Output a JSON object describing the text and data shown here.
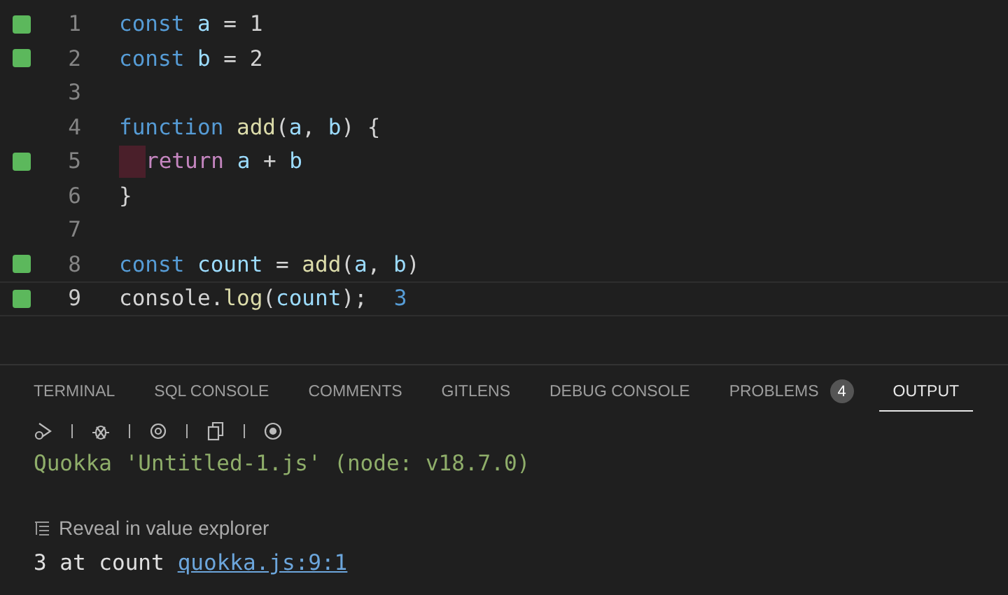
{
  "editor": {
    "lines": [
      {
        "number": "1",
        "covered": true,
        "current": false,
        "indent_error": false,
        "tokens": [
          {
            "kind": "keyword",
            "text": "const "
          },
          {
            "kind": "variable",
            "text": "a"
          },
          {
            "kind": "plain",
            "text": " = "
          },
          {
            "kind": "number",
            "text": "1"
          }
        ]
      },
      {
        "number": "2",
        "covered": true,
        "current": false,
        "indent_error": false,
        "tokens": [
          {
            "kind": "keyword",
            "text": "const "
          },
          {
            "kind": "variable",
            "text": "b"
          },
          {
            "kind": "plain",
            "text": " = "
          },
          {
            "kind": "number",
            "text": "2"
          }
        ]
      },
      {
        "number": "3",
        "covered": false,
        "current": false,
        "indent_error": false
      },
      {
        "number": "4",
        "covered": false,
        "current": false,
        "indent_error": false,
        "tokens": [
          {
            "kind": "keyword",
            "text": "function "
          },
          {
            "kind": "function",
            "text": "add"
          },
          {
            "kind": "plain",
            "text": "("
          },
          {
            "kind": "variable",
            "text": "a"
          },
          {
            "kind": "plain",
            "text": ", "
          },
          {
            "kind": "variable",
            "text": "b"
          },
          {
            "kind": "plain",
            "text": ") {"
          }
        ]
      },
      {
        "number": "5",
        "covered": true,
        "current": false,
        "indent_error": true,
        "tokens": [
          {
            "kind": "control",
            "text": "return "
          },
          {
            "kind": "variable",
            "text": "a"
          },
          {
            "kind": "plain",
            "text": " + "
          },
          {
            "kind": "variable",
            "text": "b"
          }
        ]
      },
      {
        "number": "6",
        "covered": false,
        "current": false,
        "indent_error": false,
        "tokens": [
          {
            "kind": "plain",
            "text": "}"
          }
        ]
      },
      {
        "number": "7",
        "covered": false,
        "current": false,
        "indent_error": false
      },
      {
        "number": "8",
        "covered": true,
        "current": false,
        "indent_error": false,
        "tokens": [
          {
            "kind": "keyword",
            "text": "const "
          },
          {
            "kind": "variable",
            "text": "count"
          },
          {
            "kind": "plain",
            "text": " = "
          },
          {
            "kind": "function",
            "text": "add"
          },
          {
            "kind": "plain",
            "text": "("
          },
          {
            "kind": "variable",
            "text": "a"
          },
          {
            "kind": "plain",
            "text": ", "
          },
          {
            "kind": "variable",
            "text": "b"
          },
          {
            "kind": "plain",
            "text": ")"
          }
        ]
      },
      {
        "number": "9",
        "covered": true,
        "current": true,
        "indent_error": false,
        "inline_value": "3",
        "tokens": [
          {
            "kind": "plain",
            "text": "console"
          },
          {
            "kind": "plain",
            "text": "."
          },
          {
            "kind": "function",
            "text": "log"
          },
          {
            "kind": "plain",
            "text": "("
          },
          {
            "kind": "variable",
            "text": "count"
          },
          {
            "kind": "plain",
            "text": ");"
          }
        ]
      }
    ]
  },
  "panel": {
    "tabs": [
      {
        "label": "TERMINAL",
        "selected": false
      },
      {
        "label": "SQL CONSOLE",
        "selected": false
      },
      {
        "label": "COMMENTS",
        "selected": false
      },
      {
        "label": "GITLENS",
        "selected": false
      },
      {
        "label": "DEBUG CONSOLE",
        "selected": false
      },
      {
        "label": "PROBLEMS",
        "selected": false,
        "badge": "4"
      },
      {
        "label": "OUTPUT",
        "selected": true
      }
    ],
    "output": {
      "header": "Quokka 'Untitled-1.js' (node: v18.7.0)",
      "reveal_link": "Reveal in value explorer",
      "result": {
        "text": "3 at count",
        "link": "quokka.js:9:1"
      }
    }
  }
}
